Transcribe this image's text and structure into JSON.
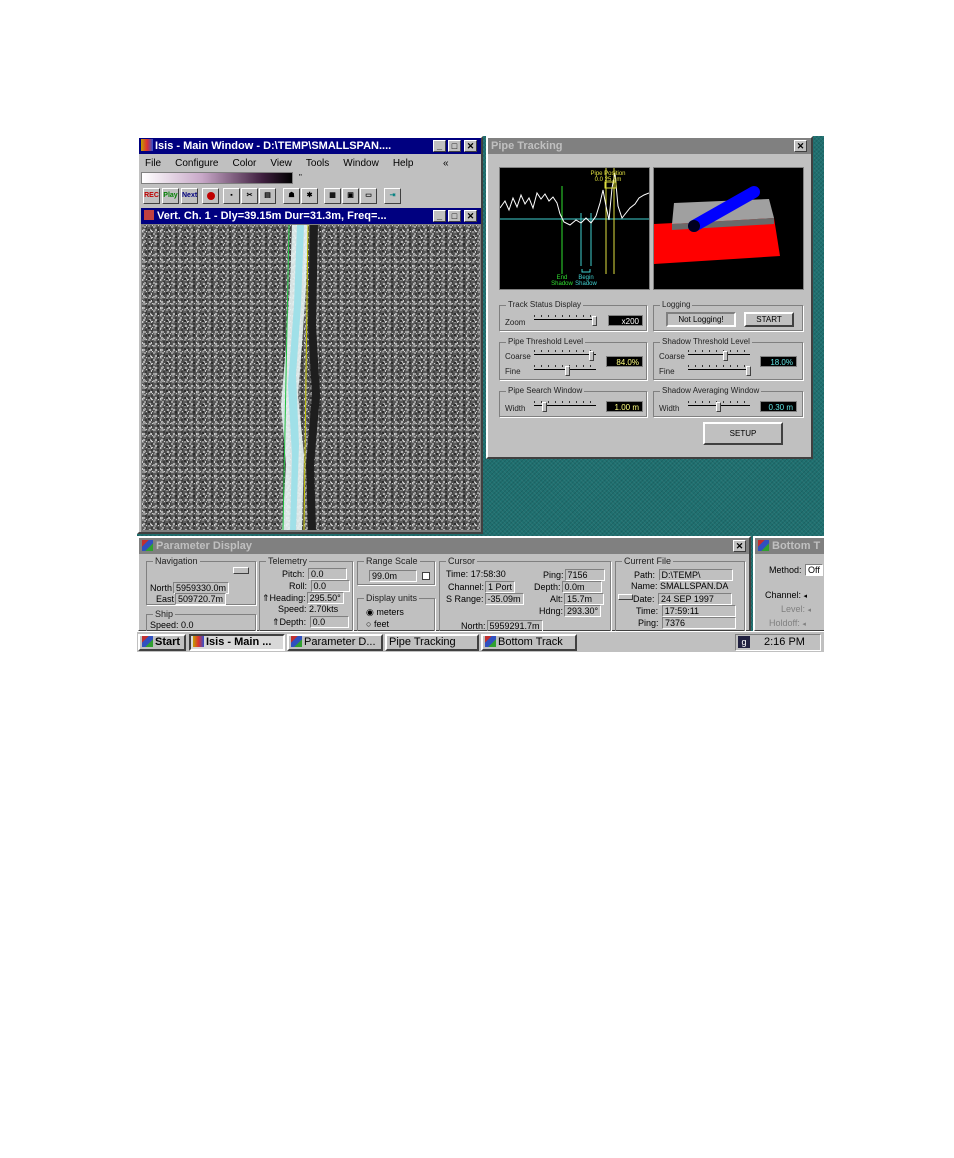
{
  "main_window": {
    "title": "Isis - Main Window - D:\\TEMP\\SMALLSPAN....",
    "menu": [
      "File",
      "Configure",
      "Color",
      "View",
      "Tools",
      "Window",
      "Help"
    ],
    "menu_extra": "«",
    "color_bar_marker": "\"",
    "toolbar": [
      "REC",
      "Play",
      "Next"
    ],
    "child_title": "Vert. Ch. 1 - Dly=39.15m Dur=31.3m, Freq=..."
  },
  "pipe_tracking": {
    "title": "Pipe Tracking",
    "plot_labels": {
      "pipe_position": "Pipe Position",
      "pipe_value": "0.0 25.8m",
      "end_shadow": "End\nShadow",
      "begin_shadow": "Begin\nShadow"
    },
    "track_status": {
      "group": "Track Status Display",
      "zoom_label": "Zoom",
      "zoom_value": "x200"
    },
    "logging": {
      "group": "Logging",
      "status": "Not Logging!",
      "start_button": "START"
    },
    "pipe_threshold": {
      "group": "Pipe Threshold Level",
      "coarse_label": "Coarse",
      "fine_label": "Fine",
      "value": "84.0%"
    },
    "shadow_threshold": {
      "group": "Shadow Threshold Level",
      "coarse_label": "Coarse",
      "fine_label": "Fine",
      "value": "18.0%"
    },
    "pipe_search": {
      "group": "Pipe Search Window",
      "width_label": "Width",
      "value": "1.00 m"
    },
    "shadow_averaging": {
      "group": "Shadow Averaging Window",
      "width_label": "Width",
      "value": "0.30 m"
    },
    "setup_button": "SETUP"
  },
  "parameter_display": {
    "title": "Parameter Display",
    "navigation": {
      "group": "Navigation",
      "north_label": "North",
      "north": "5959330.0m",
      "east_label": "East",
      "east": "509720.7m"
    },
    "ship": {
      "group": "Ship",
      "speed_label": "Speed:",
      "speed": "0.0"
    },
    "telemetry": {
      "group": "Telemetry",
      "pitch_label": "Pitch:",
      "pitch": "0.0",
      "roll_label": "Roll:",
      "roll": "0.0",
      "heading_label": "Heading:",
      "heading": "295.50°",
      "speed_label": "Speed:",
      "speed": "2.70kts",
      "depth_label": "Depth:",
      "depth": "0.0"
    },
    "range_scale": {
      "group": "Range Scale",
      "value": "99.0m"
    },
    "display_units": {
      "group": "Display units",
      "option1": "meters",
      "option2": "feet"
    },
    "cursor": {
      "group": "Cursor",
      "time_label": "Time:",
      "time": "17:58:30",
      "channel_label": "Channel:",
      "channel": "1 Port",
      "srange_label": "S Range:",
      "srange": "-35.09m",
      "ping_label": "Ping:",
      "ping": "7156",
      "depth_label": "Depth:",
      "depth": "0.0m",
      "alt_label": "Alt:",
      "alt": "15.7m",
      "hdng_label": "Hdng:",
      "hdng": "293.30°",
      "north_label": "North:",
      "north": "5959291.7m"
    },
    "current_file": {
      "group": "Current File",
      "path_label": "Path:",
      "path": "D:\\TEMP\\",
      "name_label": "Name:",
      "name": "SMALLSPAN.DA",
      "date_label": "Date:",
      "date": "24 SEP 1997",
      "time_label": "Time:",
      "time": "17:59:11",
      "ping_label": "Ping:",
      "ping": "7376"
    }
  },
  "bottom_track": {
    "title": "Bottom T",
    "method_label": "Method:",
    "method_value": "Off",
    "channel_label": "Channel:",
    "level_label": "Level:",
    "holdoff_label": "Holdoff:"
  },
  "taskbar": {
    "start": "Start",
    "items": [
      "Isis - Main ...",
      "Parameter D...",
      "Pipe Tracking",
      "Bottom Track"
    ],
    "clock": "2:16 PM"
  },
  "colors": {
    "desktop": "#1f7070",
    "titlebar_active": "#000080",
    "titlebar_inactive": "#808080",
    "window_face": "#c0c0c0"
  }
}
